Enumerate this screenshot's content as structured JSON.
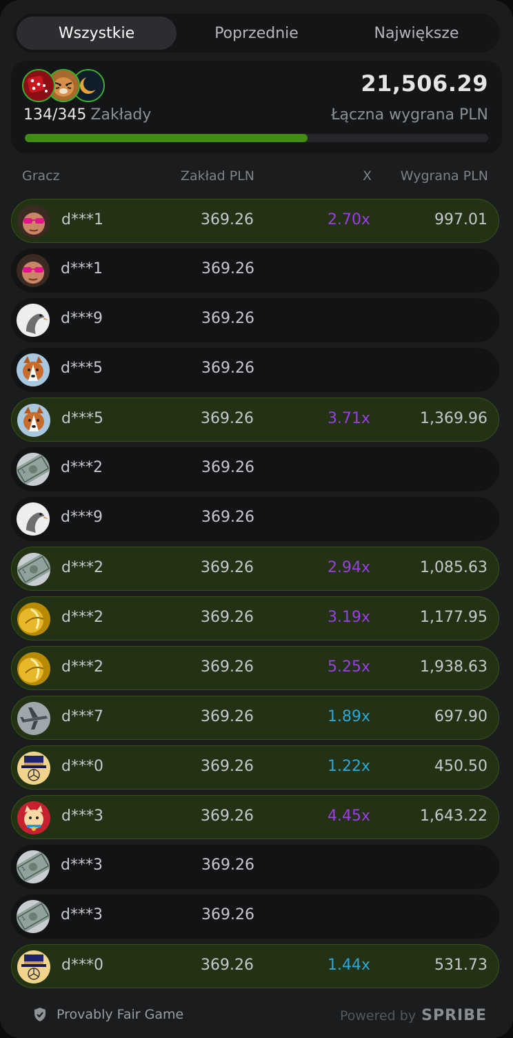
{
  "tabs": [
    {
      "label": "Wszystkie",
      "active": true
    },
    {
      "label": "Poprzednie",
      "active": false
    },
    {
      "label": "Największe",
      "active": false
    }
  ],
  "summary": {
    "bets_count": "134/345",
    "bets_label": "Zakłady",
    "total_win": "21,506.29",
    "total_win_label": "Łączna wygrana PLN",
    "progress_fraction": 0.61,
    "avatars": [
      "dice-avatar",
      "tiger-avatar",
      "moon-avatar"
    ]
  },
  "columns": {
    "player": "Gracz",
    "bet": "Zakład PLN",
    "multiplier": "X",
    "payout": "Wygrana PLN"
  },
  "rows": [
    {
      "avatar": "baby-sunglasses-avatar",
      "player": "d***1",
      "bet": "369.26",
      "multiplier": "2.70x",
      "mult_color": "purple",
      "payout": "997.01",
      "won": true
    },
    {
      "avatar": "baby-sunglasses-avatar",
      "player": "d***1",
      "bet": "369.26",
      "multiplier": "",
      "mult_color": "",
      "payout": "",
      "won": false
    },
    {
      "avatar": "vulture-avatar",
      "player": "d***9",
      "bet": "369.26",
      "multiplier": "",
      "mult_color": "",
      "payout": "",
      "won": false
    },
    {
      "avatar": "husky-avatar",
      "player": "d***5",
      "bet": "369.26",
      "multiplier": "",
      "mult_color": "",
      "payout": "",
      "won": false
    },
    {
      "avatar": "husky-avatar",
      "player": "d***5",
      "bet": "369.26",
      "multiplier": "3.71x",
      "mult_color": "purple",
      "payout": "1,369.96",
      "won": true
    },
    {
      "avatar": "dollar-avatar",
      "player": "d***2",
      "bet": "369.26",
      "multiplier": "",
      "mult_color": "",
      "payout": "",
      "won": false
    },
    {
      "avatar": "vulture-avatar",
      "player": "d***9",
      "bet": "369.26",
      "multiplier": "",
      "mult_color": "",
      "payout": "",
      "won": false
    },
    {
      "avatar": "dollar-avatar",
      "player": "d***2",
      "bet": "369.26",
      "multiplier": "2.94x",
      "mult_color": "purple",
      "payout": "1,085.63",
      "won": true
    },
    {
      "avatar": "gold-avatar",
      "player": "d***2",
      "bet": "369.26",
      "multiplier": "3.19x",
      "mult_color": "purple",
      "payout": "1,177.95",
      "won": true
    },
    {
      "avatar": "gold-avatar",
      "player": "d***2",
      "bet": "369.26",
      "multiplier": "5.25x",
      "mult_color": "purple",
      "payout": "1,938.63",
      "won": true
    },
    {
      "avatar": "airplane-avatar",
      "player": "d***7",
      "bet": "369.26",
      "multiplier": "1.89x",
      "mult_color": "blue",
      "payout": "697.90",
      "won": true
    },
    {
      "avatar": "hat-avatar",
      "player": "d***0",
      "bet": "369.26",
      "multiplier": "1.22x",
      "mult_color": "blue",
      "payout": "450.50",
      "won": true
    },
    {
      "avatar": "lucky-cat-avatar",
      "player": "d***3",
      "bet": "369.26",
      "multiplier": "4.45x",
      "mult_color": "purple",
      "payout": "1,643.22",
      "won": true
    },
    {
      "avatar": "dollar-avatar",
      "player": "d***3",
      "bet": "369.26",
      "multiplier": "",
      "mult_color": "",
      "payout": "",
      "won": false
    },
    {
      "avatar": "dollar-avatar",
      "player": "d***3",
      "bet": "369.26",
      "multiplier": "",
      "mult_color": "",
      "payout": "",
      "won": false
    },
    {
      "avatar": "hat-avatar",
      "player": "d***0",
      "bet": "369.26",
      "multiplier": "1.44x",
      "mult_color": "blue",
      "payout": "531.73",
      "won": true
    }
  ],
  "footer": {
    "provably_fair": "Provably Fair Game",
    "powered_by": "Powered by",
    "brand": "SPRIBE"
  },
  "colors": {
    "win_row_bg": "#233214",
    "progress_fill": "#3f8e13",
    "mult_purple": "#9b3fe0",
    "mult_blue": "#2da7d8"
  }
}
